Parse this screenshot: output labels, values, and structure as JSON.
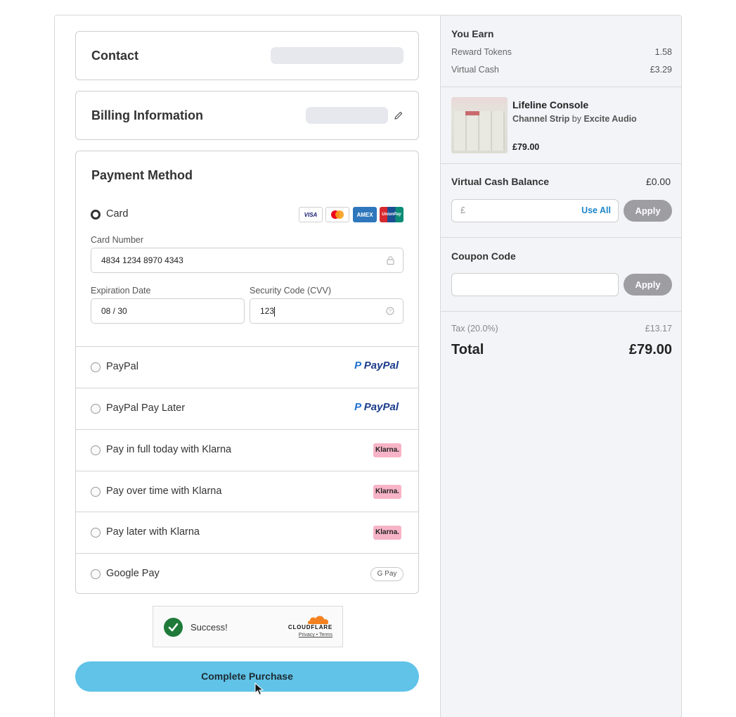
{
  "contact": {
    "title": "Contact"
  },
  "billing": {
    "title": "Billing Information"
  },
  "payment": {
    "title": "Payment Method",
    "card": {
      "label": "Card",
      "logos": [
        "VISA",
        "mastercard",
        "AMEX",
        "UnionPay"
      ],
      "card_number_label": "Card Number",
      "card_number_value": "4834 1234 8970 4343",
      "expiration_label": "Expiration Date",
      "expiration_value": "08 / 30",
      "cvv_label": "Security Code (CVV)",
      "cvv_value": "123"
    },
    "methods": [
      {
        "label": "PayPal",
        "logo": "PayPal"
      },
      {
        "label": "PayPal Pay Later",
        "logo": "PayPal"
      },
      {
        "label": "Pay in full today with Klarna",
        "logo": "Klarna."
      },
      {
        "label": "Pay over time with Klarna",
        "logo": "Klarna."
      },
      {
        "label": "Pay later with Klarna",
        "logo": "Klarna."
      },
      {
        "label": "Google Pay",
        "logo": "G Pay"
      }
    ]
  },
  "captcha": {
    "status": "Success!",
    "brand": "CLOUDFLARE",
    "links": "Privacy • Terms"
  },
  "complete_button": "Complete Purchase",
  "summary": {
    "you_earn_title": "You Earn",
    "reward_tokens_label": "Reward Tokens",
    "reward_tokens_value": "1.58",
    "virtual_cash_label": "Virtual Cash",
    "virtual_cash_value": "£3.29",
    "product": {
      "name": "Lifeline Console",
      "category": "Channel Strip",
      "by": "by",
      "vendor": "Excite Audio",
      "price": "£79.00"
    },
    "vc_balance_label": "Virtual Cash Balance",
    "vc_balance_value": "£0.00",
    "vc_input_prefix": "£",
    "use_all": "Use All",
    "apply": "Apply",
    "coupon_title": "Coupon Code",
    "tax_label": "Tax (20.0%)",
    "tax_value": "£13.17",
    "total_label": "Total",
    "total_value": "£79.00"
  },
  "colors": {
    "accent": "#60c3e7",
    "link": "#1f86c9",
    "apply_bg": "#9d9da2",
    "klarna": "#f7b4c6"
  }
}
